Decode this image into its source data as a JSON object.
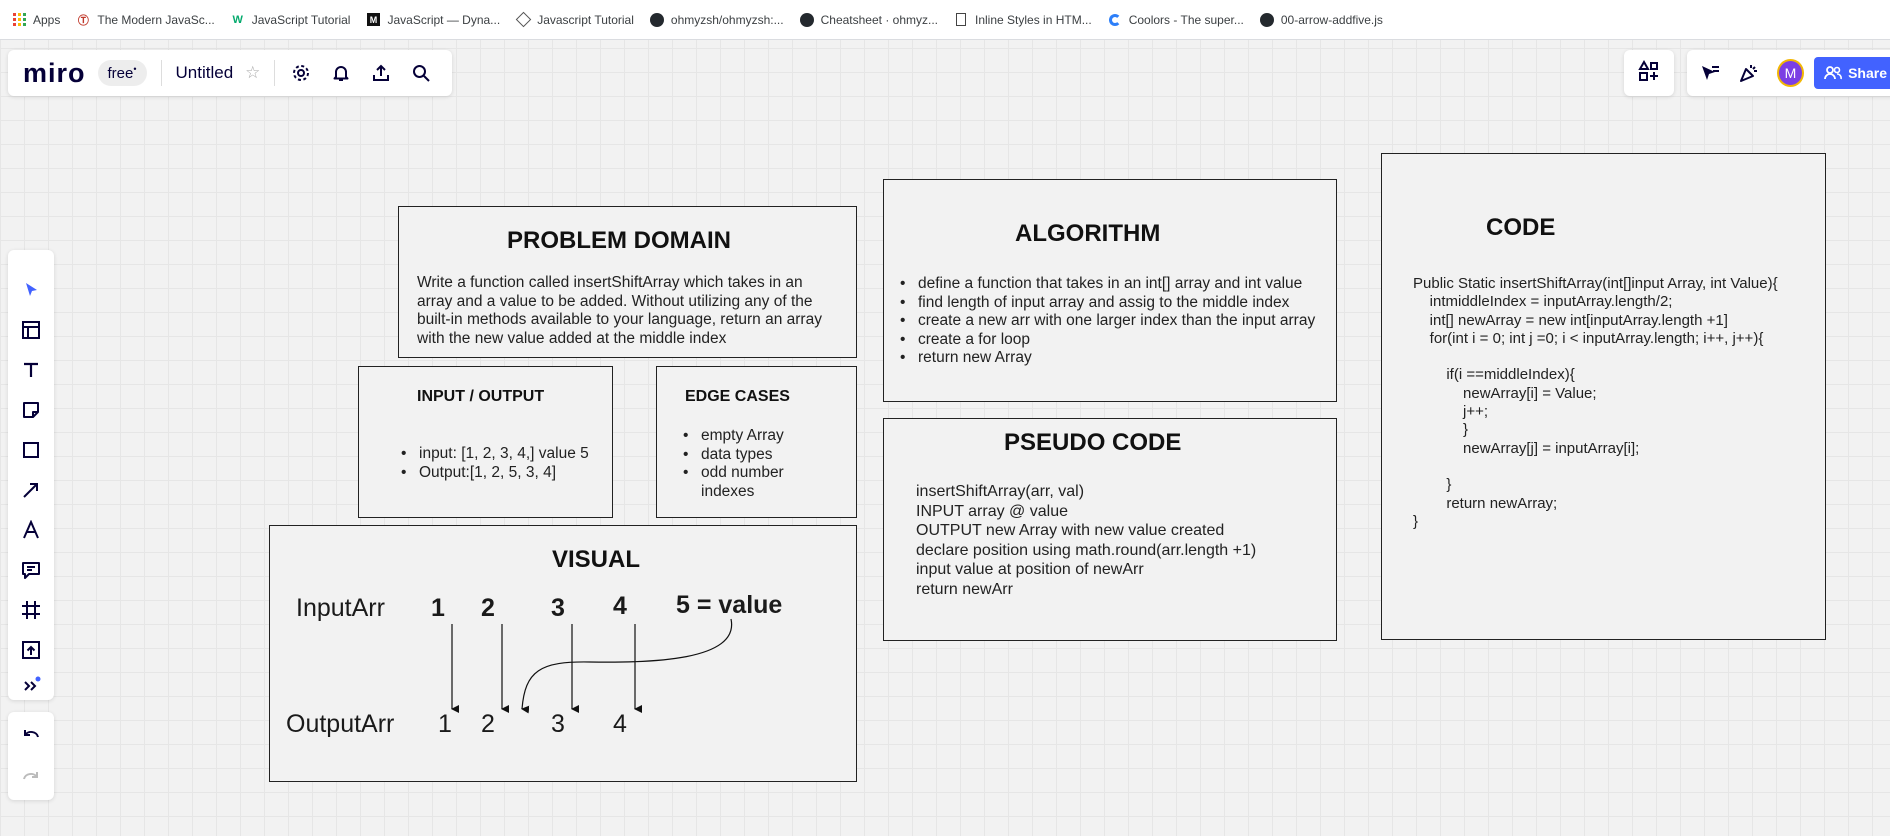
{
  "bookmarks": [
    {
      "label": "Apps",
      "icon": "apps-grid-icon"
    },
    {
      "label": "The Modern JavaSc...",
      "icon": "javascript-info-icon"
    },
    {
      "label": "JavaScript Tutorial",
      "icon": "w3schools-icon"
    },
    {
      "label": "JavaScript — Dyna...",
      "icon": "medium-icon"
    },
    {
      "label": "Javascript Tutorial",
      "icon": "diamond-site-icon"
    },
    {
      "label": "ohmyzsh/ohmyzsh:...",
      "icon": "github-icon"
    },
    {
      "label": "Cheatsheet · ohmyz...",
      "icon": "github-icon"
    },
    {
      "label": "Inline Styles in HTM...",
      "icon": "document-icon"
    },
    {
      "label": "Coolors - The super...",
      "icon": "coolors-icon"
    },
    {
      "label": "00-arrow-addfive.js",
      "icon": "github-icon"
    }
  ],
  "header": {
    "logo": "miro",
    "plan": "free",
    "board_title": "Untitled",
    "share_label": "Share",
    "avatar_initial": "M"
  },
  "colors": {
    "accent": "#4262ff",
    "avatar": "#7b3fe4"
  },
  "frames": {
    "problem_domain": {
      "title": "PROBLEM DOMAIN",
      "body": "Write a function called insertShiftArray which takes in an array and a value to be added. Without utilizing any of the built-in methods available to your language, return an array with the new value added at the middle index"
    },
    "input_output": {
      "title": "INPUT / OUTPUT",
      "items": [
        "input: [1, 2, 3, 4,] value 5",
        "Output:[1, 2, 5, 3, 4]"
      ]
    },
    "edge_cases": {
      "title": "EDGE CASES",
      "items": [
        "empty Array",
        "data types",
        "odd number indexes"
      ]
    },
    "visual": {
      "title": "VISUAL",
      "input_label": "InputArr",
      "output_label": "OutputArr",
      "input_values": [
        "1",
        "2",
        "3",
        "4"
      ],
      "inserted": "5 = value",
      "output_values": [
        "1",
        "2",
        "3",
        "4"
      ]
    },
    "algorithm": {
      "title": "ALGORITHM",
      "items": [
        "define a function that takes in an int[] array and int value",
        "find length of input array and assig to the middle index",
        "create a new arr with one larger index than the input array",
        "create a for loop",
        "return new Array"
      ]
    },
    "pseudo_code": {
      "title": "PSEUDO CODE",
      "lines": [
        "insertShiftArray(arr, val)",
        "INPUT array @ value",
        "OUTPUT new Array with new value created",
        "declare position using math.round(arr.length +1)",
        "input value at position of newArr",
        "return newArr"
      ]
    },
    "code": {
      "title": "CODE",
      "lines": [
        "Public Static insertShiftArray(int[]input Array, int Value){",
        "    intmiddleIndex = inputArray.length/2;",
        "    int[] newArray = new int[inputArray.length +1]",
        "    for(int i = 0; int j =0; i < inputArray.length; i++, j++){",
        "",
        "        if(i ==middleIndex){",
        "            newArray[i] = Value;",
        "            j++;",
        "            }",
        "            newArray[j] = inputArray[i];",
        "",
        "        }",
        "        return newArray;",
        "}"
      ]
    }
  }
}
